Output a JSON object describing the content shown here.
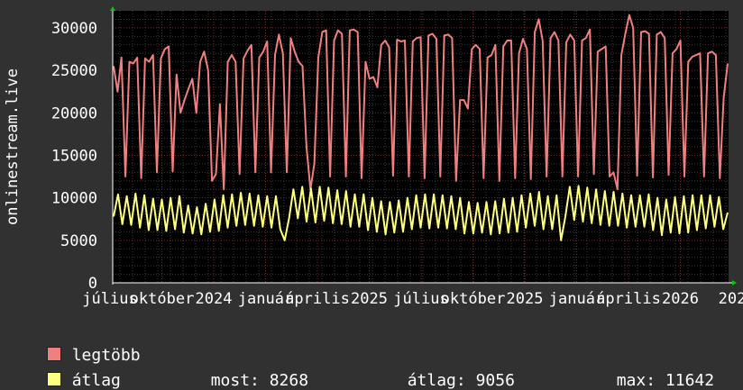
{
  "chart_data": {
    "type": "line",
    "ylabel": "onlinestream.live",
    "ylim": [
      0,
      32000
    ],
    "yticks": [
      0,
      5000,
      10000,
      15000,
      20000,
      25000,
      30000
    ],
    "ytick_labels": [
      "0",
      "5000",
      "10000",
      "15000",
      "20000",
      "25000",
      "30000"
    ],
    "x_tick_labels": [
      "július",
      "október",
      "2024",
      "január",
      "április",
      "2025",
      "július",
      "október",
      "2025",
      "január",
      "április",
      "2026",
      "202"
    ],
    "grid": true,
    "series": [
      {
        "name": "legtöbb",
        "color": "#f08080",
        "values": [
          25500,
          22500,
          26500,
          12500,
          26000,
          25800,
          26500,
          12300,
          26400,
          26000,
          26800,
          13000,
          26400,
          27500,
          27800,
          13100,
          24500,
          20000,
          21500,
          22800,
          24000,
          20000,
          26000,
          27200,
          25000,
          12000,
          12800,
          21000,
          11000,
          26000,
          26800,
          26000,
          12800,
          26400,
          27300,
          28000,
          13000,
          26500,
          27200,
          28400,
          13000,
          26800,
          29200,
          27000,
          13000,
          28800,
          27200,
          26000,
          25500,
          16000,
          11000,
          14000,
          26500,
          29500,
          29700,
          12500,
          28500,
          29700,
          29300,
          12500,
          29700,
          29800,
          29500,
          12300,
          26000,
          24000,
          24200,
          23000,
          28000,
          28500,
          27700,
          12600,
          28600,
          28400,
          28500,
          12500,
          28400,
          28800,
          28900,
          12300,
          29100,
          29300,
          28700,
          12500,
          29100,
          29200,
          28800,
          12000,
          21500,
          21500,
          20500,
          27500,
          28000,
          27500,
          12300,
          26500,
          26800,
          28000,
          12000,
          27800,
          28500,
          28500,
          12300,
          27000,
          28700,
          27500,
          12200,
          29500,
          31000,
          28500,
          12500,
          28800,
          29500,
          28500,
          12500,
          28300,
          29200,
          28500,
          12500,
          28500,
          28800,
          29800,
          12800,
          27200,
          27500,
          27800,
          12500,
          13000,
          11000,
          26800,
          29300,
          31500,
          30000,
          12600,
          29500,
          29600,
          29300,
          12400,
          29200,
          29500,
          28800,
          12700,
          27000,
          27500,
          28500,
          12500,
          26000,
          26600,
          26800,
          27000,
          12500,
          27000,
          27200,
          26800,
          12300,
          21800,
          25800
        ],
        "value_range": [
          10900,
          31500
        ]
      },
      {
        "name": "átlag",
        "color": "#ffff80",
        "values": [
          7800,
          10400,
          6900,
          10200,
          6800,
          10500,
          6500,
          10300,
          6200,
          9900,
          6200,
          9800,
          6100,
          10000,
          6300,
          10200,
          5900,
          9100,
          5800,
          8900,
          5700,
          9300,
          6000,
          9800,
          6100,
          10300,
          6500,
          10400,
          6700,
          10600,
          6800,
          10500,
          6700,
          10300,
          6600,
          10200,
          6500,
          10200,
          6300,
          5000,
          7600,
          11000,
          7600,
          11300,
          7200,
          11100,
          7100,
          11300,
          7300,
          11200,
          7000,
          10900,
          6900,
          10800,
          6600,
          10400,
          6600,
          10400,
          6200,
          10000,
          6000,
          9600,
          5700,
          9500,
          5900,
          9700,
          6000,
          10000,
          6300,
          10300,
          6500,
          10400,
          6400,
          10400,
          6500,
          10300,
          6400,
          10200,
          6300,
          10000,
          5800,
          9500,
          5800,
          9400,
          5900,
          9500,
          5700,
          9600,
          5800,
          9900,
          5900,
          10000,
          6000,
          10300,
          6500,
          10500,
          6700,
          10700,
          6300,
          10200,
          6300,
          10300,
          5000,
          7800,
          11300,
          7400,
          11400,
          7200,
          11200,
          7000,
          11000,
          6800,
          10800,
          6700,
          10700,
          6700,
          10500,
          6500,
          10300,
          6600,
          10300,
          6600,
          10400,
          6200,
          10000,
          5600,
          9800,
          5900,
          10100,
          5800,
          10200,
          5900,
          10300,
          6200,
          10300,
          6400,
          10300,
          6600,
          10100,
          6300,
          8268
        ],
        "value_range": [
          4600,
          11642
        ]
      }
    ]
  },
  "legend": {
    "items": [
      {
        "label": "legtöbb",
        "color": "#f08080"
      },
      {
        "label": "átlag",
        "color": "#ffff80"
      }
    ]
  },
  "stats": {
    "now_label": "most:",
    "now_value": "8268",
    "avg_label": "átlag:",
    "avg_value": "9056",
    "max_label": "max:",
    "max_value": "11642"
  }
}
